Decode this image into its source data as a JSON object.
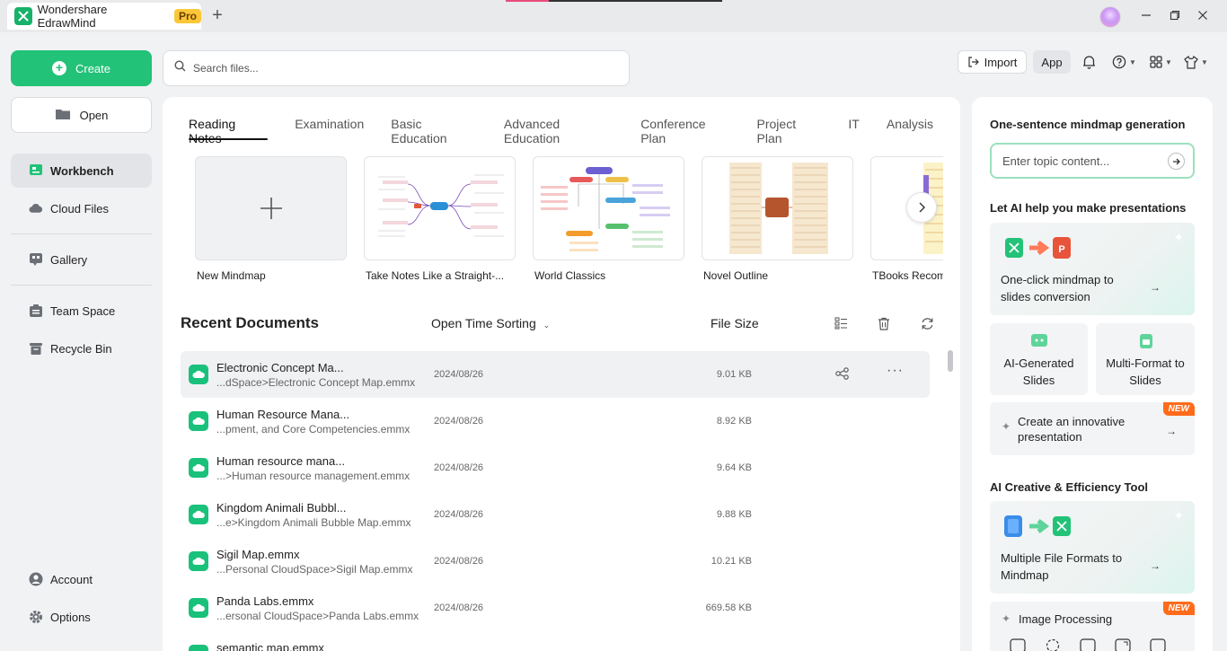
{
  "window": {
    "app_title": "Wondershare EdrawMind",
    "pro_badge": "Pro",
    "new_tab": "+"
  },
  "sidebar": {
    "create_label": "Create",
    "open_label": "Open",
    "items": [
      {
        "label": "Workbench"
      },
      {
        "label": "Cloud Files"
      },
      {
        "label": "Gallery"
      },
      {
        "label": "Team Space"
      },
      {
        "label": "Recycle Bin"
      },
      {
        "label": "Account"
      },
      {
        "label": "Options"
      }
    ]
  },
  "search": {
    "placeholder": "Search files..."
  },
  "toolbar": {
    "import_label": "Import",
    "app_label": "App"
  },
  "templates": {
    "tabs": [
      "Reading Notes",
      "Examination",
      "Basic Education",
      "Advanced Education",
      "Conference Plan",
      "Project Plan",
      "IT",
      "Analysis"
    ],
    "cards": [
      {
        "label": "New Mindmap"
      },
      {
        "label": "Take Notes Like a Straight-..."
      },
      {
        "label": "World Classics"
      },
      {
        "label": "Novel Outline"
      },
      {
        "label": "TBooks Recom"
      }
    ]
  },
  "recent": {
    "title": "Recent Documents",
    "sort_label": "Open Time Sorting",
    "size_header": "File Size",
    "rows": [
      {
        "name": "Electronic Concept Ma...",
        "path": "...dSpace>Electronic Concept Map.emmx",
        "date": "2024/08/26",
        "size": "9.01 KB"
      },
      {
        "name": "Human Resource Mana...",
        "path": "...pment, and Core Competencies.emmx",
        "date": "2024/08/26",
        "size": "8.92 KB"
      },
      {
        "name": "Human resource mana...",
        "path": "...>Human resource management.emmx",
        "date": "2024/08/26",
        "size": "9.64 KB"
      },
      {
        "name": "Kingdom Animali Bubbl...",
        "path": "...e>Kingdom Animali Bubble Map.emmx",
        "date": "2024/08/26",
        "size": "9.88 KB"
      },
      {
        "name": "Sigil Map.emmx",
        "path": "...Personal CloudSpace>Sigil Map.emmx",
        "date": "2024/08/26",
        "size": "10.21 KB"
      },
      {
        "name": "Panda Labs.emmx",
        "path": "...ersonal CloudSpace>Panda Labs.emmx",
        "date": "2024/08/26",
        "size": "669.58 KB"
      },
      {
        "name": "semantic map.emmx",
        "path": "",
        "date": "",
        "size": ""
      }
    ]
  },
  "right_panel": {
    "generation_title": "One-sentence mindmap generation",
    "topic_placeholder": "Enter topic content...",
    "presentations_title": "Let AI help you make presentations",
    "slides_conversion": "One-click mindmap to slides conversion",
    "ai_generated_slides": "AI-Generated Slides",
    "multi_format_slides": "Multi-Format to Slides",
    "innovative_presentation": "Create an innovative presentation",
    "new_tag": "NEW",
    "creative_title": "AI Creative & Efficiency Tool",
    "multiple_formats": "Multiple File Formats to Mindmap",
    "image_processing": "Image Processing"
  },
  "colors": {
    "brand_green": "#22c278",
    "new_tag": "#ff6b1a",
    "pro_badge": "#fbc739"
  }
}
